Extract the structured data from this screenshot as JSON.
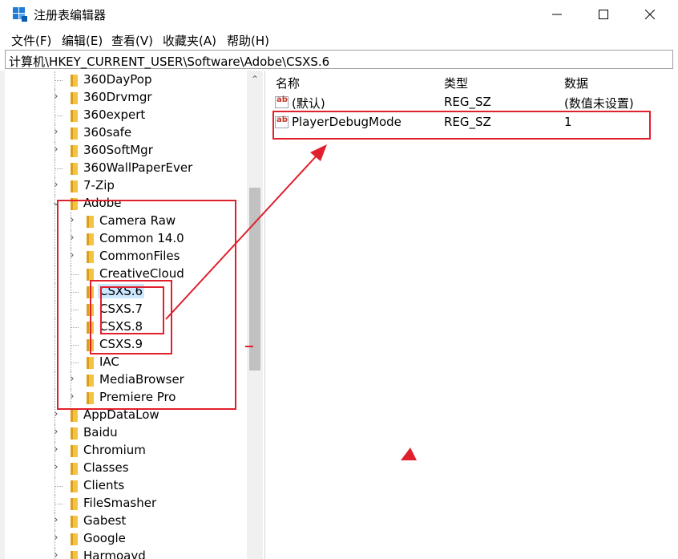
{
  "window": {
    "title": "注册表编辑器",
    "min_label": "—",
    "max_label": "☐",
    "close_label": "✕"
  },
  "menu": [
    {
      "label": "文件(F)"
    },
    {
      "label": "编辑(E)"
    },
    {
      "label": "查看(V)"
    },
    {
      "label": "收藏夹(A)"
    },
    {
      "label": "帮助(H)"
    }
  ],
  "address": "计算机\\HKEY_CURRENT_USER\\Software\\Adobe\\CSXS.6",
  "tree": {
    "items": [
      {
        "label": "360DayPop",
        "level": 0,
        "expander": "none"
      },
      {
        "label": "360Drvmgr",
        "level": 0,
        "expander": "collapsed"
      },
      {
        "label": "360expert",
        "level": 0,
        "expander": "none"
      },
      {
        "label": "360safe",
        "level": 0,
        "expander": "collapsed"
      },
      {
        "label": "360SoftMgr",
        "level": 0,
        "expander": "collapsed"
      },
      {
        "label": "360WallPaperEver",
        "level": 0,
        "expander": "none"
      },
      {
        "label": "7-Zip",
        "level": 0,
        "expander": "collapsed"
      },
      {
        "label": "Adobe",
        "level": 0,
        "expander": "expanded"
      },
      {
        "label": "Camera Raw",
        "level": 1,
        "expander": "collapsed"
      },
      {
        "label": "Common 14.0",
        "level": 1,
        "expander": "collapsed"
      },
      {
        "label": "CommonFiles",
        "level": 1,
        "expander": "collapsed"
      },
      {
        "label": "CreativeCloud",
        "level": 1,
        "expander": "none"
      },
      {
        "label": "CSXS.6",
        "level": 1,
        "expander": "none",
        "selected": true
      },
      {
        "label": "CSXS.7",
        "level": 1,
        "expander": "none"
      },
      {
        "label": "CSXS.8",
        "level": 1,
        "expander": "none"
      },
      {
        "label": "CSXS.9",
        "level": 1,
        "expander": "none"
      },
      {
        "label": "IAC",
        "level": 1,
        "expander": "none"
      },
      {
        "label": "MediaBrowser",
        "level": 1,
        "expander": "collapsed"
      },
      {
        "label": "Premiere Pro",
        "level": 1,
        "expander": "collapsed"
      },
      {
        "label": "AppDataLow",
        "level": 0,
        "expander": "collapsed"
      },
      {
        "label": "Baidu",
        "level": 0,
        "expander": "collapsed"
      },
      {
        "label": "Chromium",
        "level": 0,
        "expander": "collapsed"
      },
      {
        "label": "Classes",
        "level": 0,
        "expander": "collapsed"
      },
      {
        "label": "Clients",
        "level": 0,
        "expander": "none"
      },
      {
        "label": "FileSmasher",
        "level": 0,
        "expander": "none"
      },
      {
        "label": "Gabest",
        "level": 0,
        "expander": "collapsed"
      },
      {
        "label": "Google",
        "level": 0,
        "expander": "collapsed"
      },
      {
        "label": "Harmoayd",
        "level": 0,
        "expander": "collapsed"
      }
    ]
  },
  "list": {
    "columns": [
      "名称",
      "类型",
      "数据"
    ],
    "rows": [
      {
        "name": "(默认)",
        "type": "REG_SZ",
        "data": "(数值未设置)",
        "icon": "string-value-icon"
      },
      {
        "name": "PlayerDebugMode",
        "type": "REG_SZ",
        "data": "1",
        "icon": "string-value-icon"
      }
    ]
  },
  "colors": {
    "annotation": "#e0202c",
    "folder": "#f5c242",
    "selection": "#cce8ff"
  }
}
